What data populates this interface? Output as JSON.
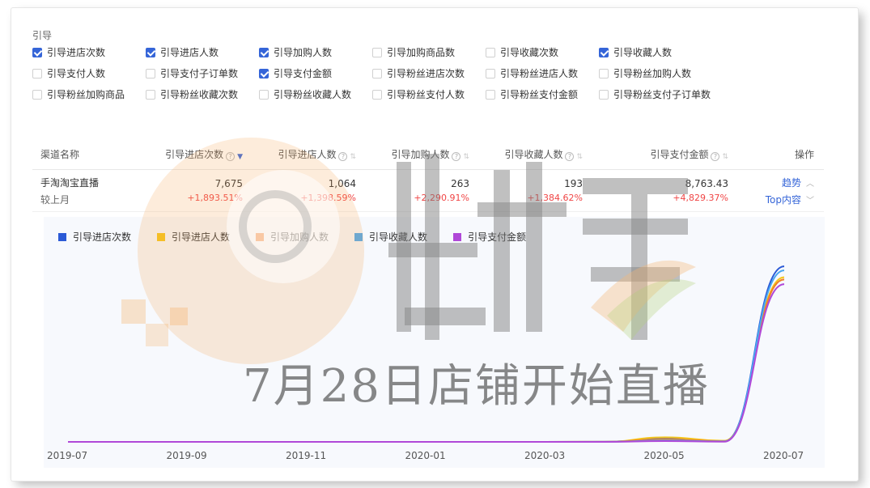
{
  "section_label": "引导",
  "metrics": [
    {
      "label": "引导进店次数",
      "checked": true
    },
    {
      "label": "引导进店人数",
      "checked": true
    },
    {
      "label": "引导加购人数",
      "checked": true
    },
    {
      "label": "引导加购商品数",
      "checked": false
    },
    {
      "label": "引导收藏次数",
      "checked": false
    },
    {
      "label": "引导收藏人数",
      "checked": true
    },
    {
      "label": "引导支付人数",
      "checked": false
    },
    {
      "label": "引导支付子订单数",
      "checked": false
    },
    {
      "label": "引导支付金额",
      "checked": true
    },
    {
      "label": "引导粉丝进店次数",
      "checked": false
    },
    {
      "label": "引导粉丝进店人数",
      "checked": false
    },
    {
      "label": "引导粉丝加购人数",
      "checked": false
    },
    {
      "label": "引导粉丝加购商品",
      "checked": false
    },
    {
      "label": "引导粉丝收藏次数",
      "checked": false
    },
    {
      "label": "引导粉丝收藏人数",
      "checked": false
    },
    {
      "label": "引导粉丝支付人数",
      "checked": false
    },
    {
      "label": "引导粉丝支付金额",
      "checked": false
    },
    {
      "label": "引导粉丝支付子订单数",
      "checked": false
    }
  ],
  "table": {
    "headers": [
      "渠道名称",
      "引导进店次数",
      "引导进店人数",
      "引导加购人数",
      "引导收藏人数",
      "引导支付金额",
      "操作"
    ],
    "row": {
      "name": "手淘淘宝直播",
      "compare": "较上月",
      "values": [
        "7,675",
        "1,064",
        "263",
        "193",
        "8,763.43"
      ],
      "deltas": [
        "+1,893.51%",
        "+1,398.59%",
        "+2,290.91%",
        "+1,384.62%",
        "+4,829.37%"
      ],
      "trend_link": "趋势",
      "top_link": "Top内容"
    }
  },
  "legend": [
    {
      "name": "引导进店次数",
      "color": "#2b5ad6"
    },
    {
      "name": "引导进店人数",
      "color": "#f5c518"
    },
    {
      "name": "引导加购人数",
      "color": "#f07d2b"
    },
    {
      "name": "引导收藏人数",
      "color": "#4aa8f0"
    },
    {
      "name": "引导支付金额",
      "color": "#b048d8"
    }
  ],
  "watermark_caption": "7月28日店铺开始直播",
  "chart_data": {
    "type": "line",
    "x": [
      "2019-07",
      "2019-08",
      "2019-09",
      "2019-10",
      "2019-11",
      "2019-12",
      "2020-01",
      "2020-02",
      "2020-03",
      "2020-04",
      "2020-05",
      "2020-06",
      "2020-07"
    ],
    "x_tick_labels": [
      "2019-07",
      "2019-09",
      "2019-11",
      "2020-01",
      "2020-03",
      "2020-05",
      "2020-07"
    ],
    "series": [
      {
        "name": "引导进店次数",
        "color": "#2b5ad6",
        "values": [
          0,
          0,
          0,
          0,
          0,
          0,
          0,
          0,
          2,
          5,
          150,
          40,
          7675
        ]
      },
      {
        "name": "引导进店人数",
        "color": "#f5c518",
        "values": [
          0,
          0,
          0,
          0,
          0,
          0,
          0,
          0,
          2,
          5,
          200,
          50,
          7200
        ]
      },
      {
        "name": "引导加购人数",
        "color": "#f07d2b",
        "values": [
          0,
          0,
          0,
          0,
          0,
          0,
          0,
          0,
          1,
          3,
          110,
          30,
          7100
        ]
      },
      {
        "name": "引导收藏人数",
        "color": "#4aa8f0",
        "values": [
          0,
          0,
          0,
          0,
          0,
          0,
          0,
          0,
          1,
          3,
          60,
          20,
          7500
        ]
      },
      {
        "name": "引导支付金额",
        "color": "#b048d8",
        "values": [
          0,
          0,
          0,
          0,
          0,
          0,
          0,
          0,
          1,
          2,
          35,
          10,
          6900
        ]
      }
    ],
    "ylim": [
      0,
      8000
    ],
    "grid": false,
    "legend_position": "top-left"
  }
}
